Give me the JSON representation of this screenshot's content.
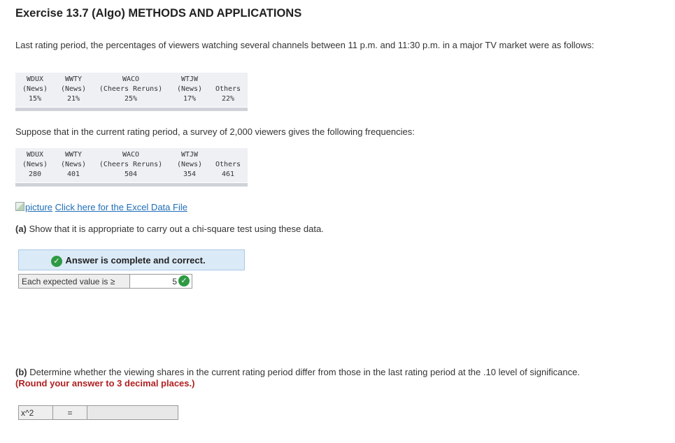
{
  "exercise_title": "Exercise 13.7 (Algo) METHODS AND APPLICATIONS",
  "intro_text": "Last rating period, the percentages of viewers watching several channels between 11 p.m. and 11:30 p.m. in a major TV market were as follows:",
  "table1": {
    "channels": [
      "WDUX",
      "WWTY",
      "WACO",
      "WTJW",
      ""
    ],
    "types": [
      "(News)",
      "(News)",
      "(Cheers Reruns)",
      "(News)",
      "Others"
    ],
    "values": [
      "15%",
      "21%",
      "25%",
      "17%",
      "22%"
    ]
  },
  "survey_text": "Suppose that in the current rating period, a survey of 2,000 viewers gives the following frequencies:",
  "table2": {
    "channels": [
      "WDUX",
      "WWTY",
      "WACO",
      "WTJW",
      ""
    ],
    "types": [
      "(News)",
      "(News)",
      "(Cheers Reruns)",
      "(News)",
      "Others"
    ],
    "values": [
      "280",
      "401",
      "504",
      "354",
      "461"
    ]
  },
  "excel_link": {
    "alt": "picture",
    "label": "Click here for the Excel Data File"
  },
  "part_a": {
    "label": "(a)",
    "text": " Show that it is appropriate to carry out a chi-square test using these data."
  },
  "answer_status": "Answer is complete and correct.",
  "expected_row": {
    "label": "Each expected value is ≥",
    "value": "5"
  },
  "part_b": {
    "label": "(b)",
    "text": " Determine whether the viewing shares in the current rating period differ from those in the last rating period at the .10 level of significance. ",
    "emphasis": "(Round your answer to 3 decimal places.)"
  },
  "chi_row": {
    "label": "x^2",
    "equals": "=",
    "value": ""
  },
  "colors": {
    "correct_green": "#2e9a44",
    "link_blue": "#1f6db8",
    "emphasis_red": "#b02020",
    "answer_banner": "#dbeaf7"
  }
}
